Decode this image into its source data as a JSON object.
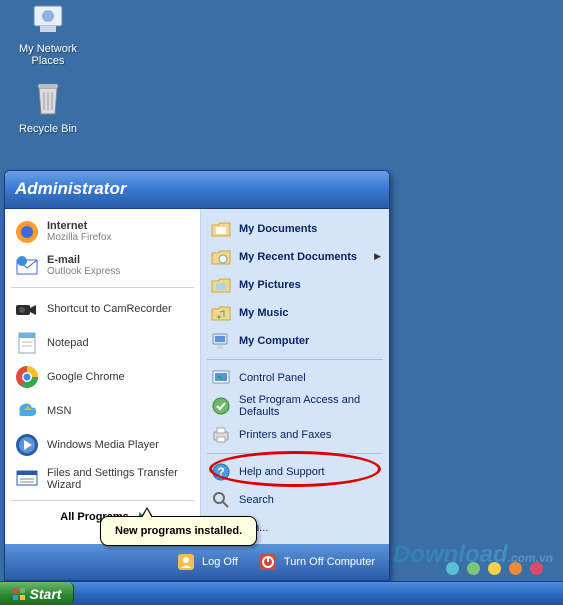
{
  "desktop": {
    "icons": [
      {
        "name": "my-network-places",
        "label": "My Network Places"
      },
      {
        "name": "recycle-bin",
        "label": "Recycle Bin"
      }
    ]
  },
  "startmenu": {
    "header": "Administrator",
    "left": {
      "internet": {
        "title": "Internet",
        "sub": "Mozilla Firefox"
      },
      "email": {
        "title": "E-mail",
        "sub": "Outlook Express"
      },
      "pinned": [
        {
          "title": "Shortcut to CamRecorder"
        },
        {
          "title": "Notepad"
        },
        {
          "title": "Google Chrome"
        },
        {
          "title": "MSN"
        },
        {
          "title": "Windows Media Player"
        },
        {
          "title": "Files and Settings Transfer Wizard"
        }
      ],
      "all_programs": "All Programs"
    },
    "right": {
      "places": [
        {
          "title": "My Documents",
          "bold": true
        },
        {
          "title": "My Recent Documents",
          "bold": true,
          "submenu": true
        },
        {
          "title": "My Pictures",
          "bold": true
        },
        {
          "title": "My Music",
          "bold": true
        },
        {
          "title": "My Computer",
          "bold": true
        }
      ],
      "settings": [
        {
          "title": "Control Panel"
        },
        {
          "title": "Set Program Access and Defaults"
        },
        {
          "title": "Printers and Faxes"
        }
      ],
      "help": [
        {
          "title": "Help and Support"
        },
        {
          "title": "Search"
        },
        {
          "title": "Run..."
        }
      ]
    },
    "footer": {
      "logoff": "Log Off",
      "turnoff": "Turn Off Computer"
    },
    "tooltip": "New programs installed."
  },
  "taskbar": {
    "start": "Start"
  },
  "watermark": {
    "main": "Download",
    "suffix": ".com.vn"
  },
  "dot_colors": [
    "#5abfd5",
    "#78c67a",
    "#f2d24b",
    "#e88b3e",
    "#d94a6e"
  ]
}
